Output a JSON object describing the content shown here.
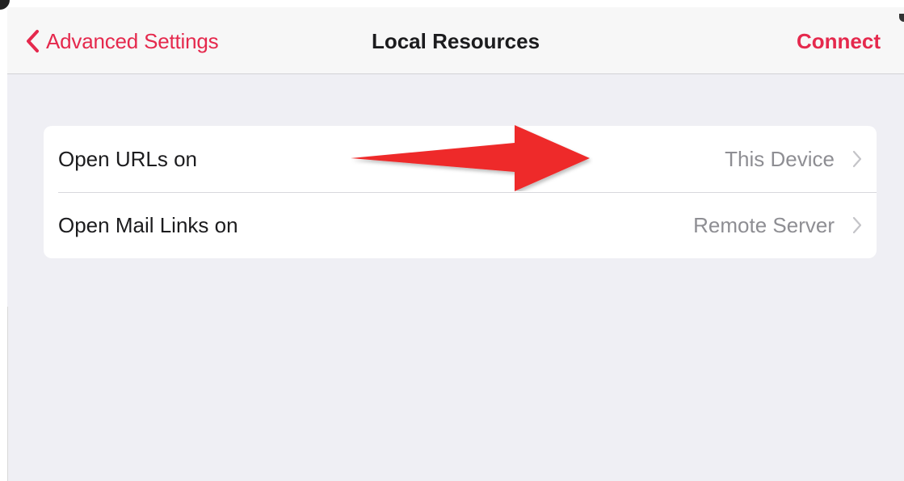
{
  "navbar": {
    "back_label": "Advanced Settings",
    "title": "Local Resources",
    "action_label": "Connect"
  },
  "settings": {
    "rows": [
      {
        "label": "Open URLs on",
        "value": "This Device"
      },
      {
        "label": "Open Mail Links on",
        "value": "Remote Server"
      }
    ]
  },
  "icons": {
    "back": "chevron-left-icon",
    "disclosure": "chevron-right-icon",
    "annotation": "red-arrow-annotation"
  },
  "colors": {
    "accent": "#e5294d",
    "background": "#efeff4",
    "navbar": "#f7f7f7",
    "cell": "#ffffff",
    "label": "#1c1c1e",
    "secondary": "#8e8e93",
    "annotation_arrow": "#ee2b2b"
  }
}
